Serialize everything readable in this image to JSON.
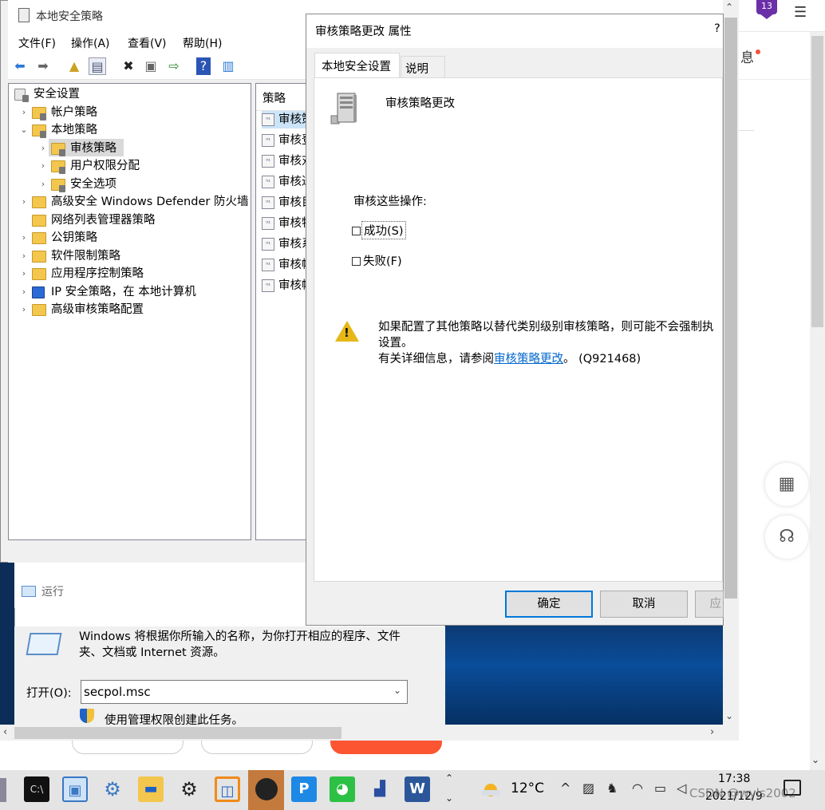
{
  "mmc": {
    "title": "本地安全策略",
    "menu": [
      "文件(F)",
      "操作(A)",
      "查看(V)",
      "帮助(H)"
    ],
    "tree": [
      {
        "label": "安全设置",
        "level": 0,
        "arrow": "",
        "icon": "security-settings-icon"
      },
      {
        "label": "帐户策略",
        "level": 1,
        "arrow": "›",
        "icon": "folder-lock-icon"
      },
      {
        "label": "本地策略",
        "level": 1,
        "arrow": "⌄",
        "icon": "folder-lock-icon"
      },
      {
        "label": "审核策略",
        "level": 2,
        "arrow": "›",
        "icon": "folder-lock-icon",
        "selected": true
      },
      {
        "label": "用户权限分配",
        "level": 2,
        "arrow": "›",
        "icon": "folder-lock-icon"
      },
      {
        "label": "安全选项",
        "level": 2,
        "arrow": "›",
        "icon": "folder-lock-icon"
      },
      {
        "label": "高级安全 Windows Defender 防火墙",
        "level": 1,
        "arrow": "›",
        "icon": "folder-icon"
      },
      {
        "label": "网络列表管理器策略",
        "level": 1,
        "arrow": "",
        "icon": "folder-icon"
      },
      {
        "label": "公钥策略",
        "level": 1,
        "arrow": "›",
        "icon": "folder-icon"
      },
      {
        "label": "软件限制策略",
        "level": 1,
        "arrow": "›",
        "icon": "folder-icon"
      },
      {
        "label": "应用程序控制策略",
        "level": 1,
        "arrow": "›",
        "icon": "folder-icon"
      },
      {
        "label": "IP 安全策略，在 本地计算机",
        "level": 1,
        "arrow": "›",
        "icon": "ip-security-icon"
      },
      {
        "label": "高级审核策略配置",
        "level": 1,
        "arrow": "›",
        "icon": "folder-icon"
      }
    ],
    "list_header": "策略",
    "list_items": [
      "审核策",
      "审核登",
      "审核对",
      "审核进",
      "审核目",
      "审核特",
      "审核系",
      "审核帐",
      "审核帐"
    ]
  },
  "props": {
    "title": "审核策略更改 属性",
    "help": "?",
    "tabs": [
      "本地安全设置",
      "说明"
    ],
    "policy_name": "审核策略更改",
    "audit_label": "审核这些操作:",
    "success_label": "成功(S)",
    "failure_label": "失败(F)",
    "success_checked": false,
    "failure_checked": false,
    "warning_line1": "如果配置了其他策略以替代类别级别审核策略，则可能不会强制执",
    "warning_line2": "设置。",
    "warning_line3_prefix": "有关详细信息，请参阅",
    "warning_link": "审核策略更改",
    "warning_line3_suffix": "。 (Q921468)",
    "btn_ok": "确定",
    "btn_cancel": "取消",
    "btn_apply": "应"
  },
  "run": {
    "title": "运行",
    "description": "Windows 将根据你所输入的名称，为你打开相应的程序、文件夹、文档或 Internet 资源。",
    "open_label": "打开(O):",
    "input_value": "secpol.msc",
    "admin_note": "使用管理权限创建此任务。"
  },
  "background": {
    "badge_count": "13",
    "message_label": "息"
  },
  "taskbar": {
    "apps": [
      "cmd-icon",
      "control-panel-icon",
      "settings-gear-icon",
      "file-explorer-icon",
      "settings-icon",
      "app-orange-icon",
      "avatar-app-icon",
      "p-app-icon",
      "wechat-icon",
      "network-app-icon",
      "word-icon"
    ],
    "temperature": "12°C",
    "time": "17:38",
    "date": "2021/12/9",
    "watermark": "CSDN @wyls2002"
  }
}
